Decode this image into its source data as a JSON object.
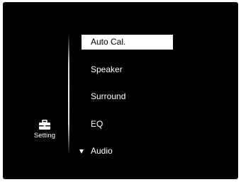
{
  "side_panel": {
    "icon": "toolbox-icon",
    "label": "Setting"
  },
  "menu": {
    "items": [
      {
        "label": "Auto Cal.",
        "selected": true
      },
      {
        "label": "Speaker",
        "selected": false
      },
      {
        "label": "Surround",
        "selected": false
      },
      {
        "label": "EQ",
        "selected": false
      },
      {
        "label": "Audio",
        "selected": false
      }
    ],
    "scroll_indicator": "down-arrow-icon"
  },
  "colors": {
    "background": "#000000",
    "text": "#ffffff",
    "highlight_bg": "#ffffff",
    "highlight_text": "#000000"
  }
}
